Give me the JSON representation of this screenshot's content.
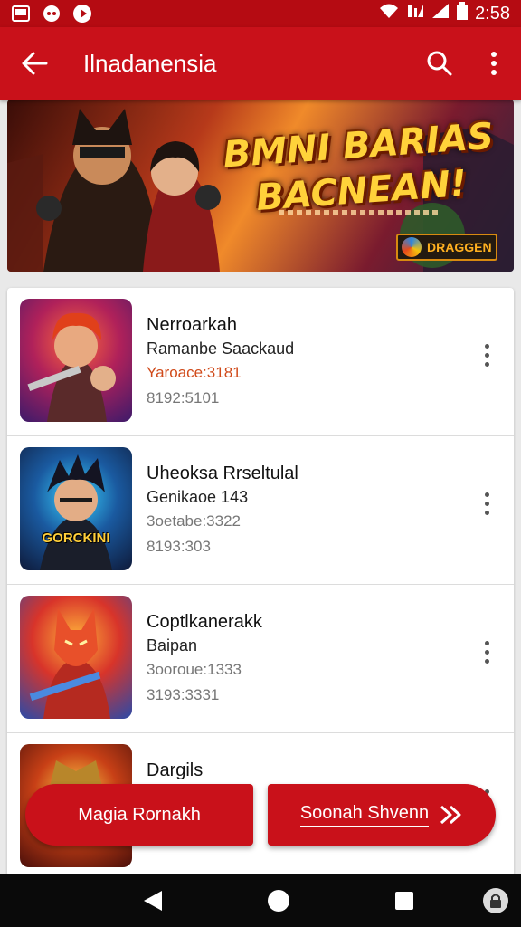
{
  "status_bar": {
    "time": "2:58"
  },
  "app_bar": {
    "title": "Ilnadanensia"
  },
  "banner": {
    "title_line1": "BMNI BARIAS",
    "title_line2": "BACNEAN!",
    "badge": "DRAGGEN"
  },
  "items": [
    {
      "title": "Nerroarkah",
      "subtitle": "Ramanbe Saackaud",
      "price": "Yaroace:3181",
      "meta": "8192:5101",
      "thumb_label": ""
    },
    {
      "title": "Uheoksa Rrseltulal",
      "subtitle": "Genikaoe 143",
      "price": "3oetabe:3322",
      "meta": "8193:303",
      "thumb_label": "GORCKINI"
    },
    {
      "title": "Coptlkanerakk",
      "subtitle": "Baipan",
      "price": "3ooroue:1333",
      "meta": "3193:3331",
      "thumb_label": ""
    },
    {
      "title": "Dargils",
      "subtitle": "",
      "price": "",
      "meta": "",
      "thumb_label": ""
    }
  ],
  "buttons": {
    "left": "Magia Rornakh",
    "right": "Soonah Shvenn"
  },
  "colors": {
    "primary": "#c9111a",
    "status_bar": "#b50b12",
    "price": "#d04a1a"
  }
}
